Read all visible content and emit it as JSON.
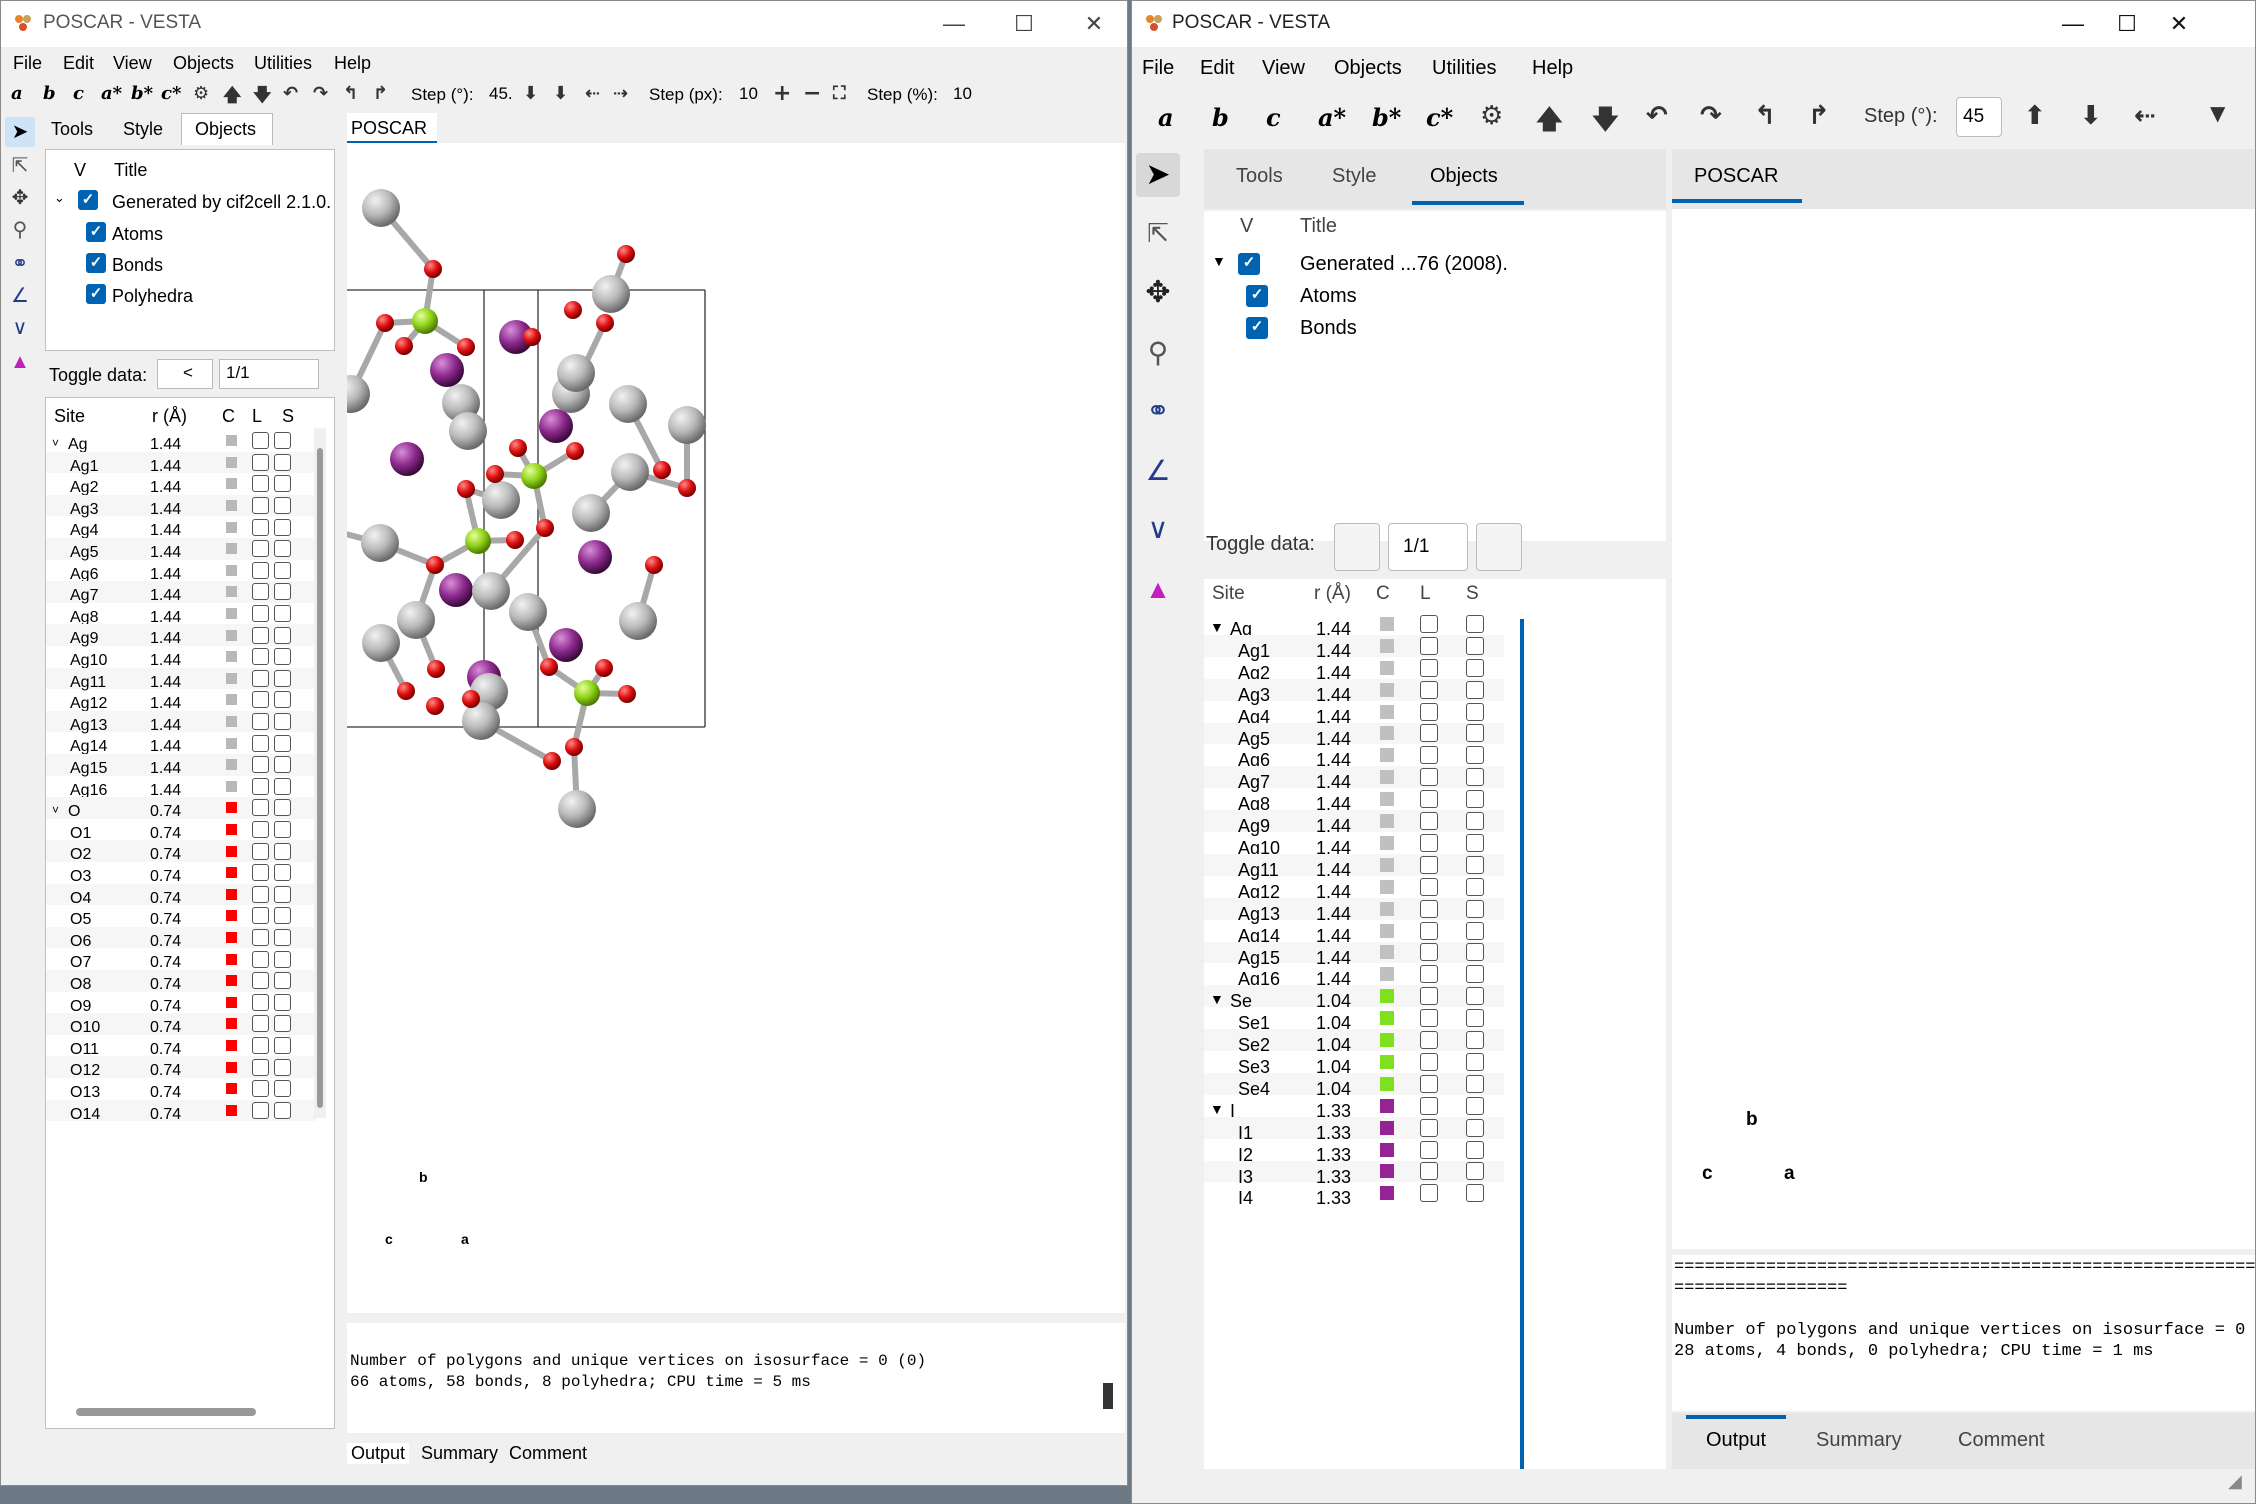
{
  "left": {
    "title": "POSCAR - VESTA",
    "menu": [
      "File",
      "Edit",
      "View",
      "Objects",
      "Utilities",
      "Help"
    ],
    "toolbar": {
      "axes": [
        "a",
        "b",
        "c",
        "a*",
        "b*",
        "c*"
      ],
      "step_deg_label": "Step (°):",
      "step_deg": "45.",
      "step_px_label": "Step (px):",
      "step_px": "10",
      "step_pct_label": "Step (%):",
      "step_pct": "10"
    },
    "tabs": [
      "Tools",
      "Style",
      "Objects"
    ],
    "view_tab": "POSCAR",
    "tree_head": [
      "V",
      "Title"
    ],
    "tree": [
      "Generated by cif2cell 2.1.0.",
      "Atoms",
      "Bonds",
      "Polyhedra"
    ],
    "toggle_label": "Toggle data:",
    "toggle_btn": "<",
    "toggle_value": "1/1",
    "site_head": [
      "Site",
      "r (Å)",
      "C",
      "L",
      "S"
    ],
    "sites": [
      {
        "name": "Ag",
        "r": "1.44",
        "group": true,
        "color": "#b8b8b8"
      },
      {
        "name": "Ag1",
        "r": "1.44",
        "color": "#b8b8b8"
      },
      {
        "name": "Ag2",
        "r": "1.44",
        "color": "#b8b8b8"
      },
      {
        "name": "Ag3",
        "r": "1.44",
        "color": "#b8b8b8"
      },
      {
        "name": "Ag4",
        "r": "1.44",
        "color": "#b8b8b8"
      },
      {
        "name": "Ag5",
        "r": "1.44",
        "color": "#b8b8b8"
      },
      {
        "name": "Ag6",
        "r": "1.44",
        "color": "#b8b8b8"
      },
      {
        "name": "Ag7",
        "r": "1.44",
        "color": "#b8b8b8"
      },
      {
        "name": "Ag8",
        "r": "1.44",
        "color": "#b8b8b8"
      },
      {
        "name": "Ag9",
        "r": "1.44",
        "color": "#b8b8b8"
      },
      {
        "name": "Ag10",
        "r": "1.44",
        "color": "#b8b8b8"
      },
      {
        "name": "Ag11",
        "r": "1.44",
        "color": "#b8b8b8"
      },
      {
        "name": "Ag12",
        "r": "1.44",
        "color": "#b8b8b8"
      },
      {
        "name": "Ag13",
        "r": "1.44",
        "color": "#b8b8b8"
      },
      {
        "name": "Ag14",
        "r": "1.44",
        "color": "#b8b8b8"
      },
      {
        "name": "Ag15",
        "r": "1.44",
        "color": "#b8b8b8"
      },
      {
        "name": "Ag16",
        "r": "1.44",
        "color": "#b8b8b8"
      },
      {
        "name": "O",
        "r": "0.74",
        "group": true,
        "color": "#ff0000"
      },
      {
        "name": "O1",
        "r": "0.74",
        "color": "#ff0000"
      },
      {
        "name": "O2",
        "r": "0.74",
        "color": "#ff0000"
      },
      {
        "name": "O3",
        "r": "0.74",
        "color": "#ff0000"
      },
      {
        "name": "O4",
        "r": "0.74",
        "color": "#ff0000"
      },
      {
        "name": "O5",
        "r": "0.74",
        "color": "#ff0000"
      },
      {
        "name": "O6",
        "r": "0.74",
        "color": "#ff0000"
      },
      {
        "name": "O7",
        "r": "0.74",
        "color": "#ff0000"
      },
      {
        "name": "O8",
        "r": "0.74",
        "color": "#ff0000"
      },
      {
        "name": "O9",
        "r": "0.74",
        "color": "#ff0000"
      },
      {
        "name": "O10",
        "r": "0.74",
        "color": "#ff0000"
      },
      {
        "name": "O11",
        "r": "0.74",
        "color": "#ff0000"
      },
      {
        "name": "O12",
        "r": "0.74",
        "color": "#ff0000"
      },
      {
        "name": "O13",
        "r": "0.74",
        "color": "#ff0000"
      },
      {
        "name": "O14",
        "r": "0.74",
        "color": "#ff0000"
      }
    ],
    "axis": {
      "a": "a",
      "b": "b",
      "c": "c"
    },
    "output": "Number of polygons and unique vertices on isosurface = 0 (0)\n66 atoms, 58 bonds, 8 polyhedra; CPU time = 5 ms",
    "bottom_tabs": [
      "Output",
      "Summary",
      "Comment"
    ]
  },
  "right": {
    "title": "POSCAR - VESTA",
    "menu": [
      "File",
      "Edit",
      "View",
      "Objects",
      "Utilities",
      "Help"
    ],
    "toolbar": {
      "axes": [
        "a",
        "b",
        "c",
        "a*",
        "b*",
        "c*"
      ],
      "step_deg_label": "Step (°):",
      "step_deg": "45"
    },
    "tabs": [
      "Tools",
      "Style",
      "Objects"
    ],
    "view_tab": "POSCAR",
    "tree_head": [
      "V",
      "Title"
    ],
    "tree": [
      "Generated ...76 (2008).",
      "Atoms",
      "Bonds"
    ],
    "toggle_label": "Toggle data:",
    "toggle_value": "1/1",
    "site_head": [
      "Site",
      "r (Å)",
      "C",
      "L",
      "S"
    ],
    "sites": [
      {
        "name": "Ag",
        "r": "1.44",
        "group": true,
        "color": "#c0c0c0"
      },
      {
        "name": "Ag1",
        "r": "1.44",
        "color": "#c0c0c0"
      },
      {
        "name": "Ag2",
        "r": "1.44",
        "color": "#c0c0c0"
      },
      {
        "name": "Ag3",
        "r": "1.44",
        "color": "#c0c0c0"
      },
      {
        "name": "Ag4",
        "r": "1.44",
        "color": "#c0c0c0"
      },
      {
        "name": "Ag5",
        "r": "1.44",
        "color": "#c0c0c0"
      },
      {
        "name": "Ag6",
        "r": "1.44",
        "color": "#c0c0c0"
      },
      {
        "name": "Ag7",
        "r": "1.44",
        "color": "#c0c0c0"
      },
      {
        "name": "Ag8",
        "r": "1.44",
        "color": "#c0c0c0"
      },
      {
        "name": "Ag9",
        "r": "1.44",
        "color": "#c0c0c0"
      },
      {
        "name": "Ag10",
        "r": "1.44",
        "color": "#c0c0c0"
      },
      {
        "name": "Ag11",
        "r": "1.44",
        "color": "#c0c0c0"
      },
      {
        "name": "Ag12",
        "r": "1.44",
        "color": "#c0c0c0"
      },
      {
        "name": "Ag13",
        "r": "1.44",
        "color": "#c0c0c0"
      },
      {
        "name": "Ag14",
        "r": "1.44",
        "color": "#c0c0c0"
      },
      {
        "name": "Ag15",
        "r": "1.44",
        "color": "#c0c0c0"
      },
      {
        "name": "Ag16",
        "r": "1.44",
        "color": "#c0c0c0"
      },
      {
        "name": "Se",
        "r": "1.04",
        "group": true,
        "color": "#7fe020"
      },
      {
        "name": "Se1",
        "r": "1.04",
        "color": "#7fe020"
      },
      {
        "name": "Se2",
        "r": "1.04",
        "color": "#7fe020"
      },
      {
        "name": "Se3",
        "r": "1.04",
        "color": "#7fe020"
      },
      {
        "name": "Se4",
        "r": "1.04",
        "color": "#7fe020"
      },
      {
        "name": "I",
        "r": "1.33",
        "group": true,
        "color": "#942494"
      },
      {
        "name": "I1",
        "r": "1.33",
        "color": "#942494"
      },
      {
        "name": "I2",
        "r": "1.33",
        "color": "#942494"
      },
      {
        "name": "I3",
        "r": "1.33",
        "color": "#942494"
      },
      {
        "name": "I4",
        "r": "1.33",
        "color": "#942494"
      }
    ],
    "axis": {
      "a": "a",
      "b": "b",
      "c": "c"
    },
    "output": "=================================================================\n=================\n\nNumber of polygons and unique vertices on isosurface = 0 (0)\n28 atoms, 4 bonds, 0 polyhedra; CPU time = 1 ms",
    "bottom_tabs": [
      "Output",
      "Summary",
      "Comment"
    ]
  },
  "colors": {
    "silver": "#b9b9bb",
    "oxygen": "#e01010",
    "selenium": "#8fd31a",
    "iodine": "#8e2a8e",
    "accent": "#0063b1"
  }
}
